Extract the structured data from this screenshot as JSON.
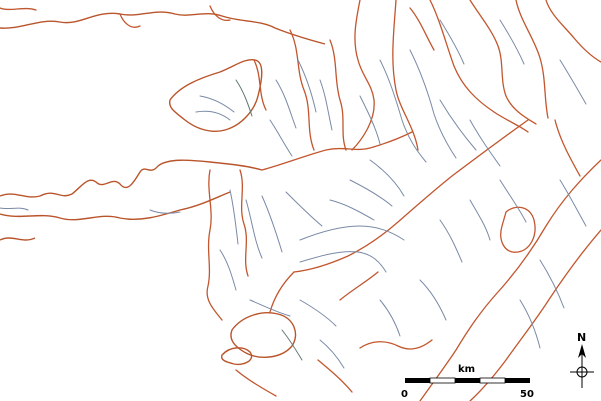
{
  "map": {
    "scale_bar": {
      "unit_label": "km",
      "start_label": "0",
      "end_label": "50"
    },
    "north_arrow": {
      "label": "N"
    },
    "colors": {
      "roads": "#c2562e",
      "rivers": "#7a8aa6",
      "background": "#ffffff"
    }
  }
}
